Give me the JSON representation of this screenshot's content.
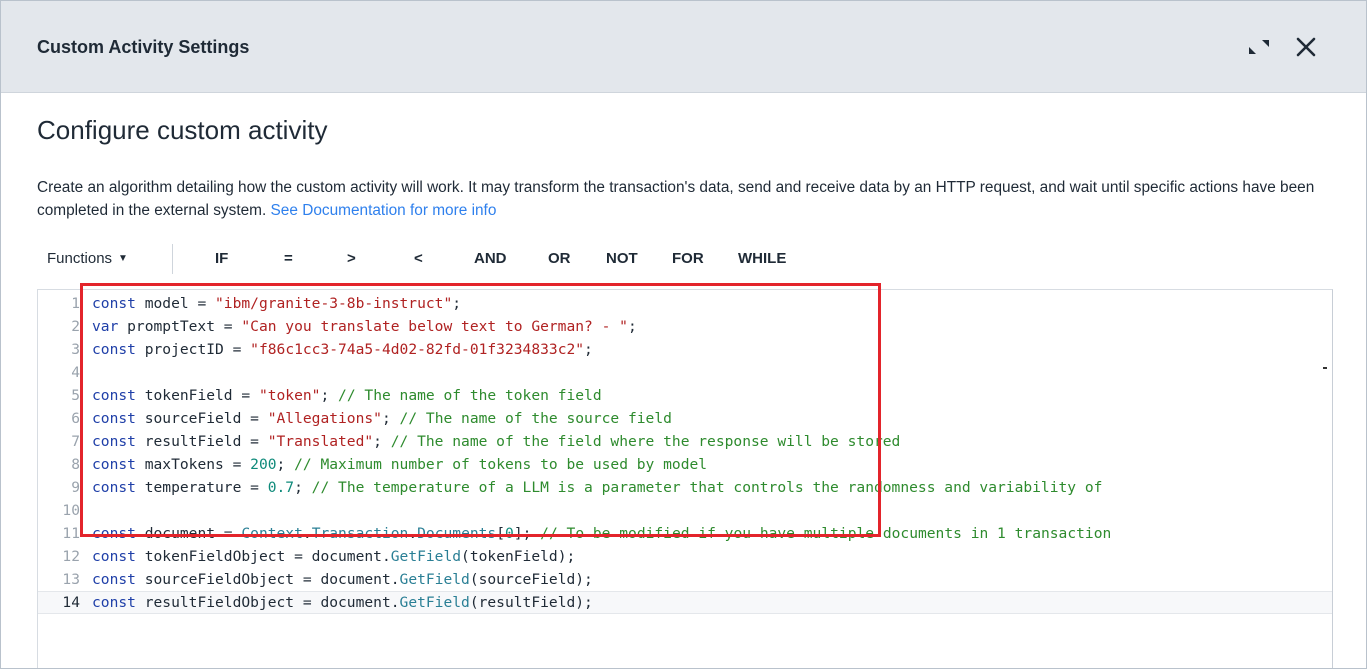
{
  "dialog": {
    "title": "Custom Activity Settings",
    "expand_icon": "expand-icon",
    "close_icon": "close-icon"
  },
  "section": {
    "title": "Configure custom activity",
    "description": "Create an algorithm detailing how the custom activity will work. It may transform the transaction's data, send and receive data by an HTTP request, and wait until specific actions have been completed in the external system.",
    "doc_link": "See Documentation for more info"
  },
  "toolbar": {
    "functions_label": "Functions",
    "operators": [
      "IF",
      "=",
      ">",
      "<",
      "AND",
      "OR",
      "NOT",
      "FOR",
      "WHILE"
    ]
  },
  "editor": {
    "active_line": 14,
    "lines": [
      {
        "n": "1",
        "tokens": [
          [
            "kw",
            "const"
          ],
          [
            "plain",
            " model = "
          ],
          [
            "str",
            "\"ibm/granite-3-8b-instruct\""
          ],
          [
            "plain",
            ";"
          ]
        ]
      },
      {
        "n": "2",
        "tokens": [
          [
            "kw",
            "var"
          ],
          [
            "plain",
            " promptText = "
          ],
          [
            "str",
            "\"Can you translate below text to German? - \""
          ],
          [
            "plain",
            ";"
          ]
        ]
      },
      {
        "n": "3",
        "tokens": [
          [
            "kw",
            "const"
          ],
          [
            "plain",
            " projectID = "
          ],
          [
            "str",
            "\"f86c1cc3-74a5-4d02-82fd-01f3234833c2\""
          ],
          [
            "plain",
            ";"
          ]
        ]
      },
      {
        "n": "4",
        "tokens": []
      },
      {
        "n": "5",
        "tokens": [
          [
            "kw",
            "const"
          ],
          [
            "plain",
            " tokenField = "
          ],
          [
            "str",
            "\"token\""
          ],
          [
            "plain",
            "; "
          ],
          [
            "cm",
            "// The name of the token field"
          ]
        ]
      },
      {
        "n": "6",
        "tokens": [
          [
            "kw",
            "const"
          ],
          [
            "plain",
            " sourceField = "
          ],
          [
            "str",
            "\"Allegations\""
          ],
          [
            "plain",
            "; "
          ],
          [
            "cm",
            "// The name of the source field"
          ]
        ]
      },
      {
        "n": "7",
        "tokens": [
          [
            "kw",
            "const"
          ],
          [
            "plain",
            " resultField = "
          ],
          [
            "str",
            "\"Translated\""
          ],
          [
            "plain",
            "; "
          ],
          [
            "cm",
            "// The name of the field where the response will be stored"
          ]
        ]
      },
      {
        "n": "8",
        "tokens": [
          [
            "kw",
            "const"
          ],
          [
            "plain",
            " maxTokens = "
          ],
          [
            "num",
            "200"
          ],
          [
            "plain",
            "; "
          ],
          [
            "cm",
            "// Maximum number of tokens to be used by model"
          ]
        ]
      },
      {
        "n": "9",
        "tokens": [
          [
            "kw",
            "const"
          ],
          [
            "plain",
            " temperature = "
          ],
          [
            "num",
            "0.7"
          ],
          [
            "plain",
            "; "
          ],
          [
            "cm",
            "// The temperature of a LLM is a parameter that controls the randomness and variability of"
          ]
        ]
      },
      {
        "n": "10",
        "tokens": []
      },
      {
        "n": "11",
        "tokens": [
          [
            "kw",
            "const"
          ],
          [
            "plain",
            " document = "
          ],
          [
            "obj",
            "Context"
          ],
          [
            "plain",
            "."
          ],
          [
            "obj",
            "Transaction"
          ],
          [
            "plain",
            "."
          ],
          [
            "obj",
            "Documents"
          ],
          [
            "plain",
            "["
          ],
          [
            "num",
            "0"
          ],
          [
            "plain",
            "]; "
          ],
          [
            "cm",
            "// To be modified if you have multiple documents in 1 transaction"
          ]
        ]
      },
      {
        "n": "12",
        "tokens": [
          [
            "kw",
            "const"
          ],
          [
            "plain",
            " tokenFieldObject = document."
          ],
          [
            "fnc",
            "GetField"
          ],
          [
            "plain",
            "(tokenField);"
          ]
        ]
      },
      {
        "n": "13",
        "tokens": [
          [
            "kw",
            "const"
          ],
          [
            "plain",
            " sourceFieldObject = document."
          ],
          [
            "fnc",
            "GetField"
          ],
          [
            "plain",
            "(sourceField);"
          ]
        ]
      },
      {
        "n": "14",
        "tokens": [
          [
            "kw",
            "const"
          ],
          [
            "plain",
            " resultFieldObject = document."
          ],
          [
            "fnc",
            "GetField"
          ],
          [
            "plain",
            "(resultField);"
          ]
        ]
      }
    ]
  },
  "colors": {
    "header_bg": "#e3e7ec",
    "highlight_border": "#e3242b",
    "link": "#2f80ed",
    "keyword": "#1f3fa8",
    "string": "#b02222",
    "comment": "#2e8b2e",
    "number": "#0e8a7a"
  }
}
